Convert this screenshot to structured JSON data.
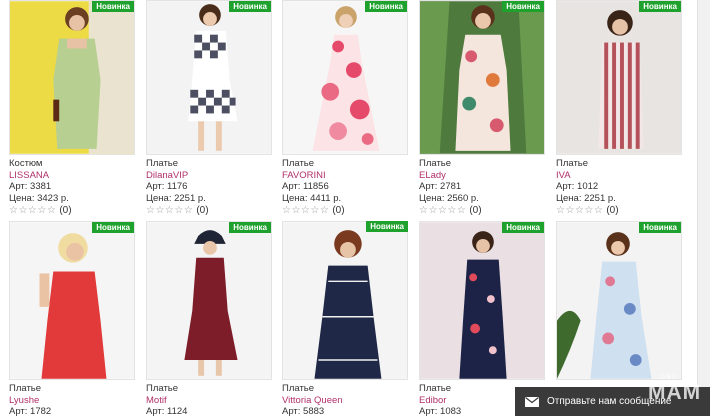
{
  "products": [
    {
      "type": "Костюм",
      "brand": "LISSANA",
      "art": "Арт: 3381",
      "price": "Цена: 3423 р.",
      "badge": "Новинка",
      "rating_count": "(0)",
      "stars": "☆☆☆☆☆"
    },
    {
      "type": "Платье",
      "brand": "DilanaVIP",
      "art": "Арт: 1176",
      "price": "Цена: 2251 р.",
      "badge": "Новинка",
      "rating_count": "(0)",
      "stars": "☆☆☆☆☆"
    },
    {
      "type": "Платье",
      "brand": "FAVORINI",
      "art": "Арт: 11856",
      "price": "Цена: 4411 р.",
      "badge": "Новинка",
      "rating_count": "(0)",
      "stars": "☆☆☆☆☆"
    },
    {
      "type": "Платье",
      "brand": "ELady",
      "art": "Арт: 2781",
      "price": "Цена: 2560 р.",
      "badge": "Новинка",
      "rating_count": "(0)",
      "stars": "☆☆☆☆☆"
    },
    {
      "type": "Платье",
      "brand": "IVA",
      "art": "Арт: 1012",
      "price": "Цена: 2251 р.",
      "badge": "Новинка",
      "rating_count": "(0)",
      "stars": "☆☆☆☆☆"
    },
    {
      "type": "Платье",
      "brand": "Lyushe",
      "art": "Арт: 1782",
      "badge": "Новинка"
    },
    {
      "type": "Платье",
      "brand": "Motif",
      "art": "Арт: 1124",
      "badge": "Новинка"
    },
    {
      "type": "Платье",
      "brand": "Vittoria Queen",
      "art": "Арт: 5883",
      "badge": "Новинка"
    },
    {
      "type": "Платье",
      "brand": "Edibor",
      "art": "Арт: 1083",
      "badge": "Новинка"
    },
    {
      "type": "",
      "brand": "",
      "art": "",
      "badge": "Новинка"
    }
  ],
  "chat": {
    "label": "Отправьте нам сообщение"
  },
  "watermark": {
    "text": "MAM",
    "small": "ОБЗ"
  },
  "colors": {
    "badge": "#1fa22d",
    "brand_link": "#b0306a"
  }
}
